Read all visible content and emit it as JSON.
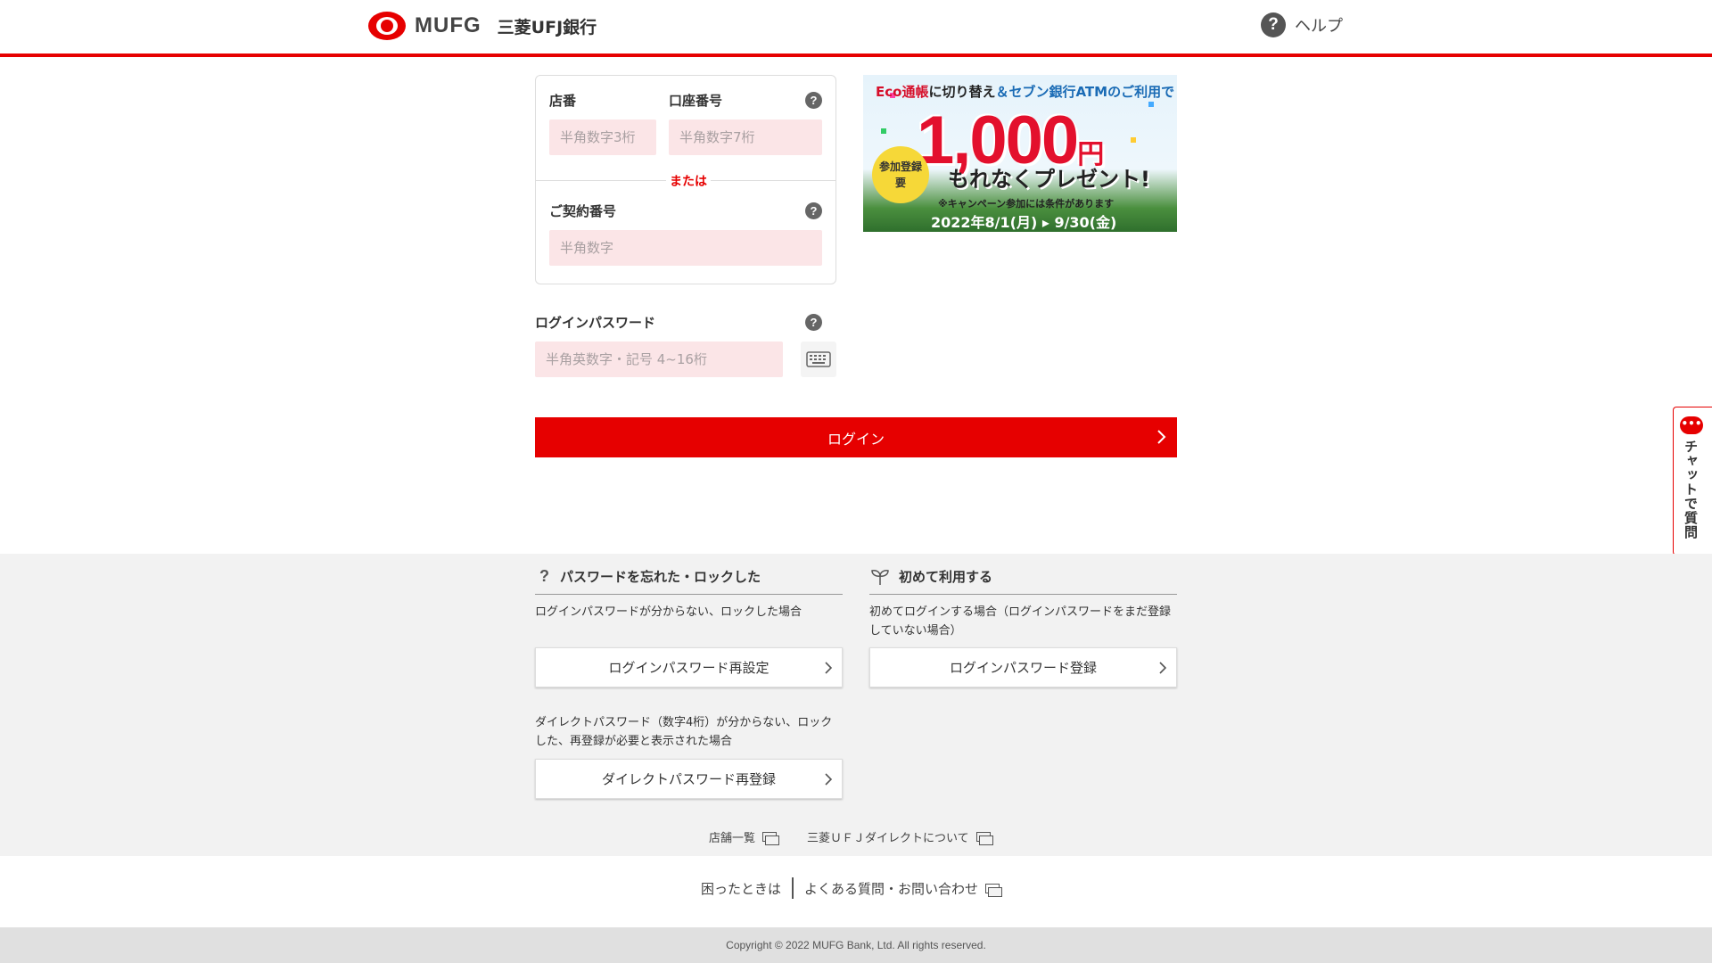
{
  "header": {
    "logo_text": "MUFG",
    "bank_name": "三菱UFJ銀行",
    "help_label": "ヘルプ"
  },
  "login_form": {
    "branch_label": "店番",
    "branch_placeholder": "半角数字3桁",
    "account_label": "口座番号",
    "account_placeholder": "半角数字7桁",
    "or_text": "または",
    "contract_label": "ご契約番号",
    "contract_placeholder": "半角数字",
    "password_label": "ログインパスワード",
    "password_placeholder": "半角英数字・記号 4~16桁",
    "help_icon_text": "?",
    "login_button": "ログイン"
  },
  "banner": {
    "top_line_a": "Eco通帳",
    "top_line_b": "に切り替え",
    "top_line_c": "＆セブン銀行ATMのご利用で",
    "badge": "参加登録 要",
    "amount": "1,000",
    "unit": "円",
    "present": "もれなくプレゼント!",
    "condition": "※キャンペーン参加には条件があります",
    "dates": "2022年8/1(月) ▸ 9/30(金)"
  },
  "chat": {
    "label": "チャットで質問"
  },
  "forgot_section": {
    "title": "パスワードを忘れた・ロックした",
    "desc1": "ログインパスワードが分からない、ロックした場合",
    "btn1": "ログインパスワード再設定",
    "desc2": "ダイレクトパスワード（数字4桁）が分からない、ロックした、再登録が必要と表示された場合",
    "btn2": "ダイレクトパスワード再登録"
  },
  "first_section": {
    "title": "初めて利用する",
    "desc1": "初めてログインする場合（ログインパスワードをまだ登録していない場合）",
    "btn1": "ログインパスワード登録"
  },
  "links": {
    "stores": "店舗一覧",
    "about": "三菱ＵＦＪダイレクトについて"
  },
  "help_links": {
    "trouble": "困ったときは",
    "faq": "よくある質問・お問い合わせ"
  },
  "footer": {
    "copyright": "Copyright © 2022 MUFG Bank, Ltd. All rights reserved."
  },
  "colors": {
    "brand_red": "#e60000",
    "input_bg": "#fbe5e7",
    "section_bg": "#f2f2f2"
  }
}
